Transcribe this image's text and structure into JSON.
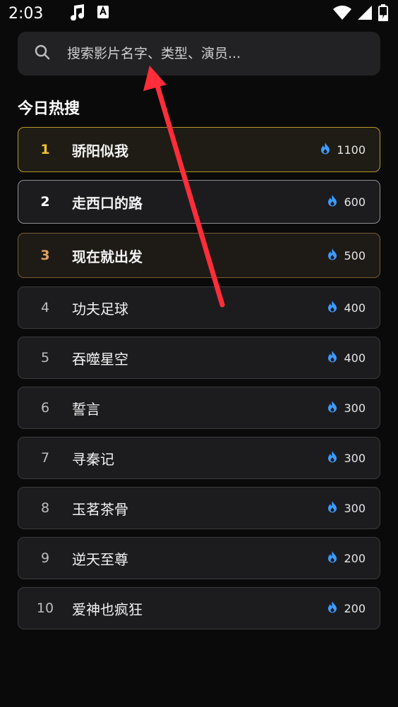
{
  "status": {
    "time": "2:03",
    "battery_level": 0.4
  },
  "search": {
    "placeholder": "搜索影片名字、类型、演员..."
  },
  "section": {
    "title": "今日热搜"
  },
  "hot_list": [
    {
      "rank": "1",
      "title": "骄阳似我",
      "hot": "1100"
    },
    {
      "rank": "2",
      "title": "走西口的路",
      "hot": "600"
    },
    {
      "rank": "3",
      "title": "现在就出发",
      "hot": "500"
    },
    {
      "rank": "4",
      "title": "功夫足球",
      "hot": "400"
    },
    {
      "rank": "5",
      "title": "吞噬星空",
      "hot": "400"
    },
    {
      "rank": "6",
      "title": "誓言",
      "hot": "300"
    },
    {
      "rank": "7",
      "title": "寻秦记",
      "hot": "300"
    },
    {
      "rank": "8",
      "title": "玉茗茶骨",
      "hot": "300"
    },
    {
      "rank": "9",
      "title": "逆天至尊",
      "hot": "200"
    },
    {
      "rank": "10",
      "title": "爱神也疯狂",
      "hot": "200"
    }
  ],
  "colors": {
    "hot_icon": "#3d9bff",
    "gold": "#f2c230",
    "bronze": "#e0a060",
    "annotation_arrow": "#ff2d3a"
  },
  "icons": [
    "music-note-icon",
    "app-notification-icon",
    "wifi-icon",
    "signal-icon",
    "battery-icon",
    "search-icon",
    "fire-icon"
  ]
}
